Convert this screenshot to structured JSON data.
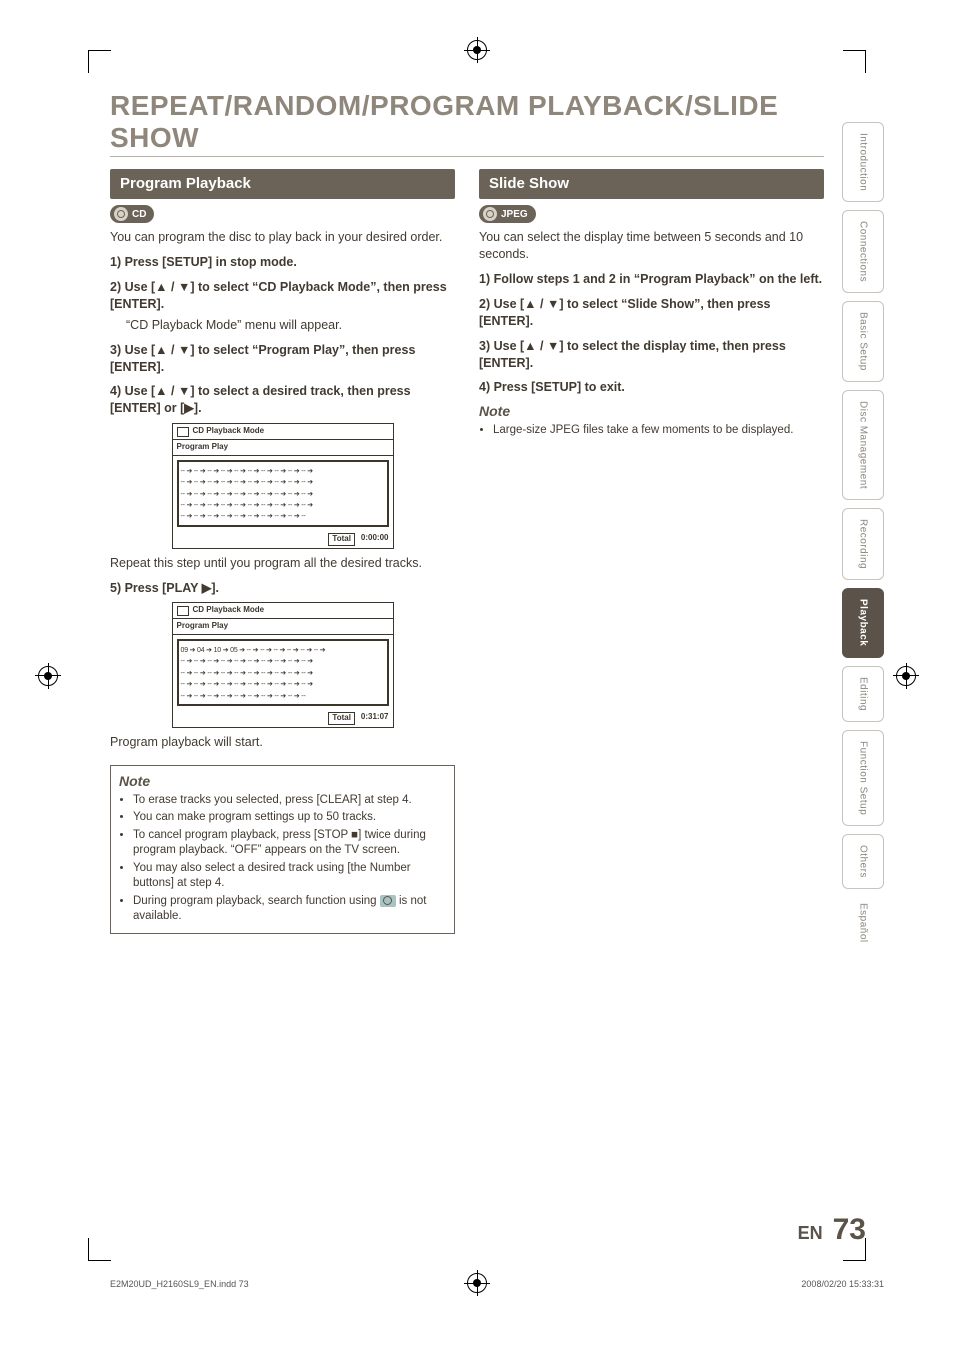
{
  "page": {
    "title": "REPEAT/RANDOM/PROGRAM PLAYBACK/SLIDE SHOW",
    "page_label": "EN",
    "page_no": "73",
    "footer_left": "E2M20UD_H2160SL9_EN.indd   73",
    "footer_right": "2008/02/20   15:33:31"
  },
  "sidetabs": [
    {
      "label": "Introduction",
      "active": false
    },
    {
      "label": "Connections",
      "active": false
    },
    {
      "label": "Basic Setup",
      "active": false
    },
    {
      "label": "Disc\nManagement",
      "active": false
    },
    {
      "label": "Recording",
      "active": false
    },
    {
      "label": "Playback",
      "active": true
    },
    {
      "label": "Editing",
      "active": false
    },
    {
      "label": "Function Setup",
      "active": false
    },
    {
      "label": "Others",
      "active": false
    },
    {
      "label": "Español",
      "active": false,
      "noframe": true
    }
  ],
  "left": {
    "section": "Program Playback",
    "chip": "CD",
    "intro": "You can program the disc to play back in your desired order.",
    "step1": "1) Press [SETUP] in stop mode.",
    "step2a": "2) Use [▲ / ▼] to select “CD Playback Mode”, then press [ENTER].",
    "step2b": "“CD Playback Mode” menu will appear.",
    "step3": "3) Use [▲ / ▼] to select “Program Play”, then press [ENTER].",
    "step4": "4) Use [▲ / ▼] to select a desired track, then press [ENTER] or [▶].",
    "osd1": {
      "title": "CD Playback Mode",
      "subtitle": "Program Play",
      "rows": [
        "-- ➔ -- ➔ -- ➔ -- ➔ -- ➔ -- ➔ -- ➔ -- ➔ -- ➔ -- ➔",
        "-- ➔ -- ➔ -- ➔ -- ➔ -- ➔ -- ➔ -- ➔ -- ➔ -- ➔ -- ➔",
        "-- ➔ -- ➔ -- ➔ -- ➔ -- ➔ -- ➔ -- ➔ -- ➔ -- ➔ -- ➔",
        "-- ➔ -- ➔ -- ➔ -- ➔ -- ➔ -- ➔ -- ➔ -- ➔ -- ➔ -- ➔",
        "-- ➔ -- ➔ -- ➔ -- ➔ -- ➔ -- ➔ -- ➔ -- ➔ -- ➔ --"
      ],
      "total_label": "Total",
      "total_value": "0:00:00"
    },
    "after_osd1": "Repeat this step until you program all the desired tracks.",
    "step5": "5) Press [PLAY ▶].",
    "osd2": {
      "title": "CD Playback Mode",
      "subtitle": "Program Play",
      "rows": [
        "09 ➔ 04 ➔ 10 ➔ 05 ➔ -- ➔ -- ➔ -- ➔ -- ➔ -- ➔ -- ➔",
        "-- ➔ -- ➔ -- ➔ -- ➔ -- ➔ -- ➔ -- ➔ -- ➔ -- ➔ -- ➔",
        "-- ➔ -- ➔ -- ➔ -- ➔ -- ➔ -- ➔ -- ➔ -- ➔ -- ➔ -- ➔",
        "-- ➔ -- ➔ -- ➔ -- ➔ -- ➔ -- ➔ -- ➔ -- ➔ -- ➔ -- ➔",
        "-- ➔ -- ➔ -- ➔ -- ➔ -- ➔ -- ➔ -- ➔ -- ➔ -- ➔ --"
      ],
      "total_label": "Total",
      "total_value": "0:31:07"
    },
    "after_osd2": "Program playback will start.",
    "note_title": "Note",
    "notes": [
      "To erase tracks you selected, press [CLEAR] at step 4.",
      "You can make program settings up to 50 tracks.",
      "To cancel program playback, press [STOP ■] twice during program playback. “OFF” appears on the TV screen.",
      "You may also select a desired track using [the Number buttons] at step 4.",
      "During program playback, search function using    is not available."
    ]
  },
  "right": {
    "section": "Slide Show",
    "chip": "JPEG",
    "intro": "You can select the display time between 5 seconds and 10 seconds.",
    "step1": "1) Follow steps 1 and 2 in “Program Playback” on the left.",
    "step2": "2) Use [▲ / ▼] to select “Slide Show”, then press [ENTER].",
    "step3": "3) Use [▲ / ▼] to select the display time, then press [ENTER].",
    "step4": "4) Press [SETUP] to exit.",
    "note_title": "Note",
    "notes": [
      "Large-size JPEG files take a few moments to be displayed."
    ]
  }
}
